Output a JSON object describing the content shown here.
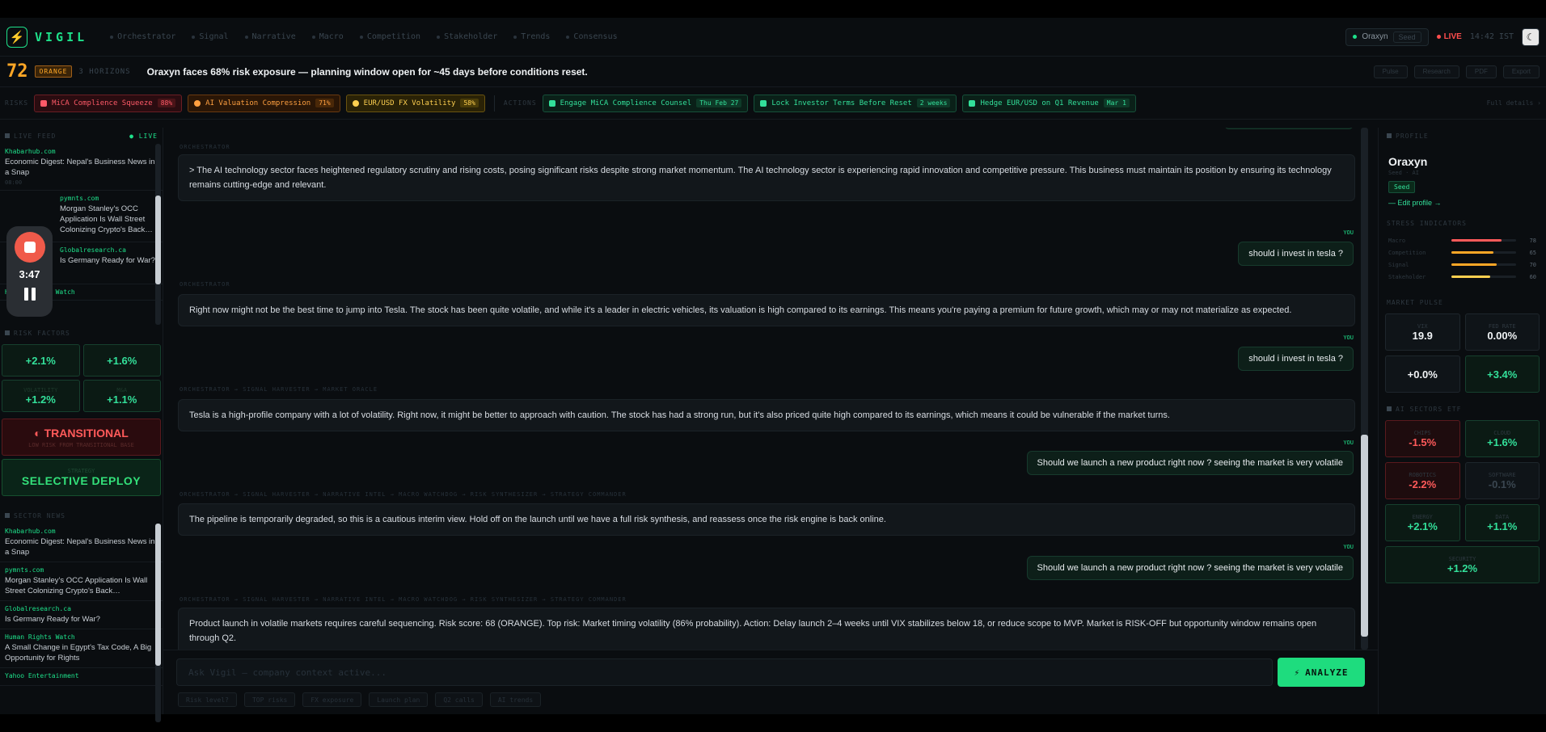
{
  "app": {
    "logo_icon": "bolt-icon",
    "name": "VIGIL"
  },
  "nav": {
    "tabs": [
      "Orchestrator",
      "Signal",
      "Narrative",
      "Macro",
      "Competition",
      "Stakeholder",
      "Trends",
      "Consensus"
    ],
    "company": "Oraxyn",
    "company_sub": "Seed",
    "live": "LIVE",
    "clock": "14:42 IST",
    "theme_icon": "moon-icon"
  },
  "headline": {
    "score": "72",
    "level": "ORANGE",
    "horizon": "3 HORIZONS",
    "text": "Oraxyn faces 68% risk exposure — planning window open for ~45 days before conditions reset.",
    "buttons": [
      "Pulse",
      "Research",
      "PDF",
      "Export"
    ]
  },
  "risks": {
    "label": "RISKS",
    "items": [
      {
        "text": "MiCA Complience Squeeze",
        "pct": "88%"
      },
      {
        "text": "AI Valuation Compression",
        "pct": "71%"
      },
      {
        "text": "EUR/USD FX Volatility",
        "pct": "58%"
      }
    ]
  },
  "actions": {
    "label": "ACTIONS",
    "items": [
      {
        "text": "Engage MiCA Complience Counsel",
        "tag": "Thu Feb 27"
      },
      {
        "text": "Lock Investor Terms Before Reset",
        "tag": "2 weeks"
      },
      {
        "text": "Hedge EUR/USD on Q1 Revenue",
        "tag": "Mar 1"
      }
    ],
    "full_details": "Full details ›"
  },
  "left": {
    "live_feed": {
      "title": "LIVE FEED",
      "live": "● LIVE",
      "items": [
        {
          "src": "Khabarhub.com",
          "title": "Economic Digest: Nepal's Business News in a Snap",
          "time": "08:00"
        },
        {
          "src": "pymnts.com",
          "title": "Morgan Stanley's OCC Application Is Wall Street Colonizing Crypto's Back…",
          "time": ""
        },
        {
          "src": "Globalresearch.ca",
          "title": "Is Germany Ready for War?",
          "time": ""
        },
        {
          "src": "Human Rights Watch",
          "title": "",
          "time": ""
        }
      ]
    },
    "risk_factors": {
      "title": "RISK FACTORS",
      "tiles": [
        {
          "label": "",
          "value": "+2.1%"
        },
        {
          "label": "",
          "value": "+1.6%"
        },
        {
          "label": "VOLATILITY",
          "value": "+1.2%"
        },
        {
          "label": "M&A",
          "value": "+1.1%"
        }
      ]
    },
    "regime": {
      "value": "◐ TRANSITIONAL",
      "sub": "LOW RISK FROM TRANSITIONAL BASE"
    },
    "deploy": {
      "label": "STRATEGY",
      "value": "SELECTIVE DEPLOY"
    },
    "sector_news": {
      "title": "SECTOR NEWS",
      "items": [
        {
          "src": "Khabarhub.com",
          "title": "Economic Digest: Nepal's Business News in a Snap"
        },
        {
          "src": "pymnts.com",
          "title": "Morgan Stanley's OCC Application Is Wall Street Colonizing Crypto's Back…"
        },
        {
          "src": "Globalresearch.ca",
          "title": "Is Germany Ready for War?"
        },
        {
          "src": "Human Rights Watch",
          "title": "A Small Change in Egypt's Tax Code, A Big Opportunity for Rights"
        },
        {
          "src": "Yahoo Entertainment",
          "title": ""
        }
      ]
    }
  },
  "recorder": {
    "time": "3:47",
    "stop_icon": "stop-icon",
    "pause_icon": "pause-icon"
  },
  "chat": {
    "you_label": "YOU",
    "messages": [
      {
        "role": "bot",
        "label": "ORCHESTRATOR",
        "text": "> The AI technology sector faces heightened regulatory scrutiny and rising costs, posing significant risks despite strong market momentum. The AI technology sector is experiencing rapid innovation and competitive pressure. This business must maintain its position by ensuring its technology remains cutting-edge and relevant."
      },
      {
        "role": "user",
        "text": "should i invest in tesla ?"
      },
      {
        "role": "bot",
        "label": "ORCHESTRATOR",
        "text": "Right now might not be the best time to jump into Tesla. The stock has been quite volatile, and while it's a leader in electric vehicles, its valuation is high compared to its earnings. This means you're paying a premium for future growth, which may or may not materialize as expected."
      },
      {
        "role": "user",
        "text": "should i invest in tesla ?"
      },
      {
        "role": "bot",
        "label": "ORCHESTRATOR → SIGNAL HARVESTER → MARKET ORACLE",
        "text": "Tesla is a high-profile company with a lot of volatility. Right now, it might be better to approach with caution. The stock has had a strong run, but it's also priced quite high compared to its earnings, which means it could be vulnerable if the market turns."
      },
      {
        "role": "user",
        "text": "Should we launch a new product right now ? seeing the market is very volatile"
      },
      {
        "role": "bot",
        "label": "ORCHESTRATOR → SIGNAL HARVESTER → NARRATIVE INTEL → MACRO WATCHDOG → RISK SYNTHESIZER → STRATEGY COMMANDER",
        "text": "The pipeline is temporarily degraded, so this is a cautious interim view. Hold off on the launch until we have a full risk synthesis, and reassess once the risk engine is back online."
      },
      {
        "role": "user",
        "text": "Should we launch a new product right now ? seeing the market is very volatile"
      },
      {
        "role": "bot",
        "label": "ORCHESTRATOR → SIGNAL HARVESTER → NARRATIVE INTEL → MACRO WATCHDOG → RISK SYNTHESIZER → STRATEGY COMMANDER",
        "text": "Product launch in volatile markets requires careful sequencing. Risk score: 68 (ORANGE). Top risk: Market timing volatility (86% probability). Action: Delay launch 2–4 weeks until VIX stabilizes below 18, or reduce scope to MVP. Market is RISK-OFF but opportunity window remains open through Q2."
      }
    ],
    "input_placeholder": "Ask Vigil — company context active...",
    "analyze_label": "ANALYZE",
    "analyze_icon": "bolt-icon",
    "chips": [
      "Risk level?",
      "TOP risks",
      "FX exposure",
      "Launch plan",
      "Q2 calls",
      "AI trends"
    ]
  },
  "right": {
    "profile": {
      "title": "PROFILE",
      "name": "Oraxyn",
      "stage": "Seed · AI",
      "badge": "Seed",
      "edit": "— Edit profile →"
    },
    "stress": {
      "title": "STRESS INDICATORS",
      "rows": [
        {
          "label": "Macro",
          "value": 78,
          "color": "#ff5a5a"
        },
        {
          "label": "Competition",
          "value": 65,
          "color": "#ffa726"
        },
        {
          "label": "Signal",
          "value": 70,
          "color": "#ffa726"
        },
        {
          "label": "Stakeholder",
          "value": 60,
          "color": "#ffd050"
        }
      ]
    },
    "market": {
      "title": "MARKET PULSE",
      "tiles": [
        {
          "label": "VIX",
          "value": "19.9",
          "style": ""
        },
        {
          "label": "FED RATE",
          "value": "0.00%",
          "style": ""
        },
        {
          "label": "",
          "value": "+0.0%",
          "style": ""
        },
        {
          "label": "",
          "value": "+3.4%",
          "style": "green"
        }
      ]
    },
    "sectors": {
      "title": "AI SECTORS ETF",
      "tiles": [
        {
          "label": "CHIPS",
          "value": "-1.5%",
          "style": "red"
        },
        {
          "label": "CLOUD",
          "value": "+1.6%",
          "style": "green"
        },
        {
          "label": "ROBOTICS",
          "value": "-2.2%",
          "style": "red"
        },
        {
          "label": "SOFTWARE",
          "value": "-0.1%",
          "style": "gray"
        },
        {
          "label": "ENERGY",
          "value": "+2.1%",
          "style": "green"
        },
        {
          "label": "DATA",
          "value": "+1.1%",
          "style": "green"
        },
        {
          "label": "SECURITY",
          "value": "+1.2%",
          "style": "green"
        }
      ]
    }
  }
}
